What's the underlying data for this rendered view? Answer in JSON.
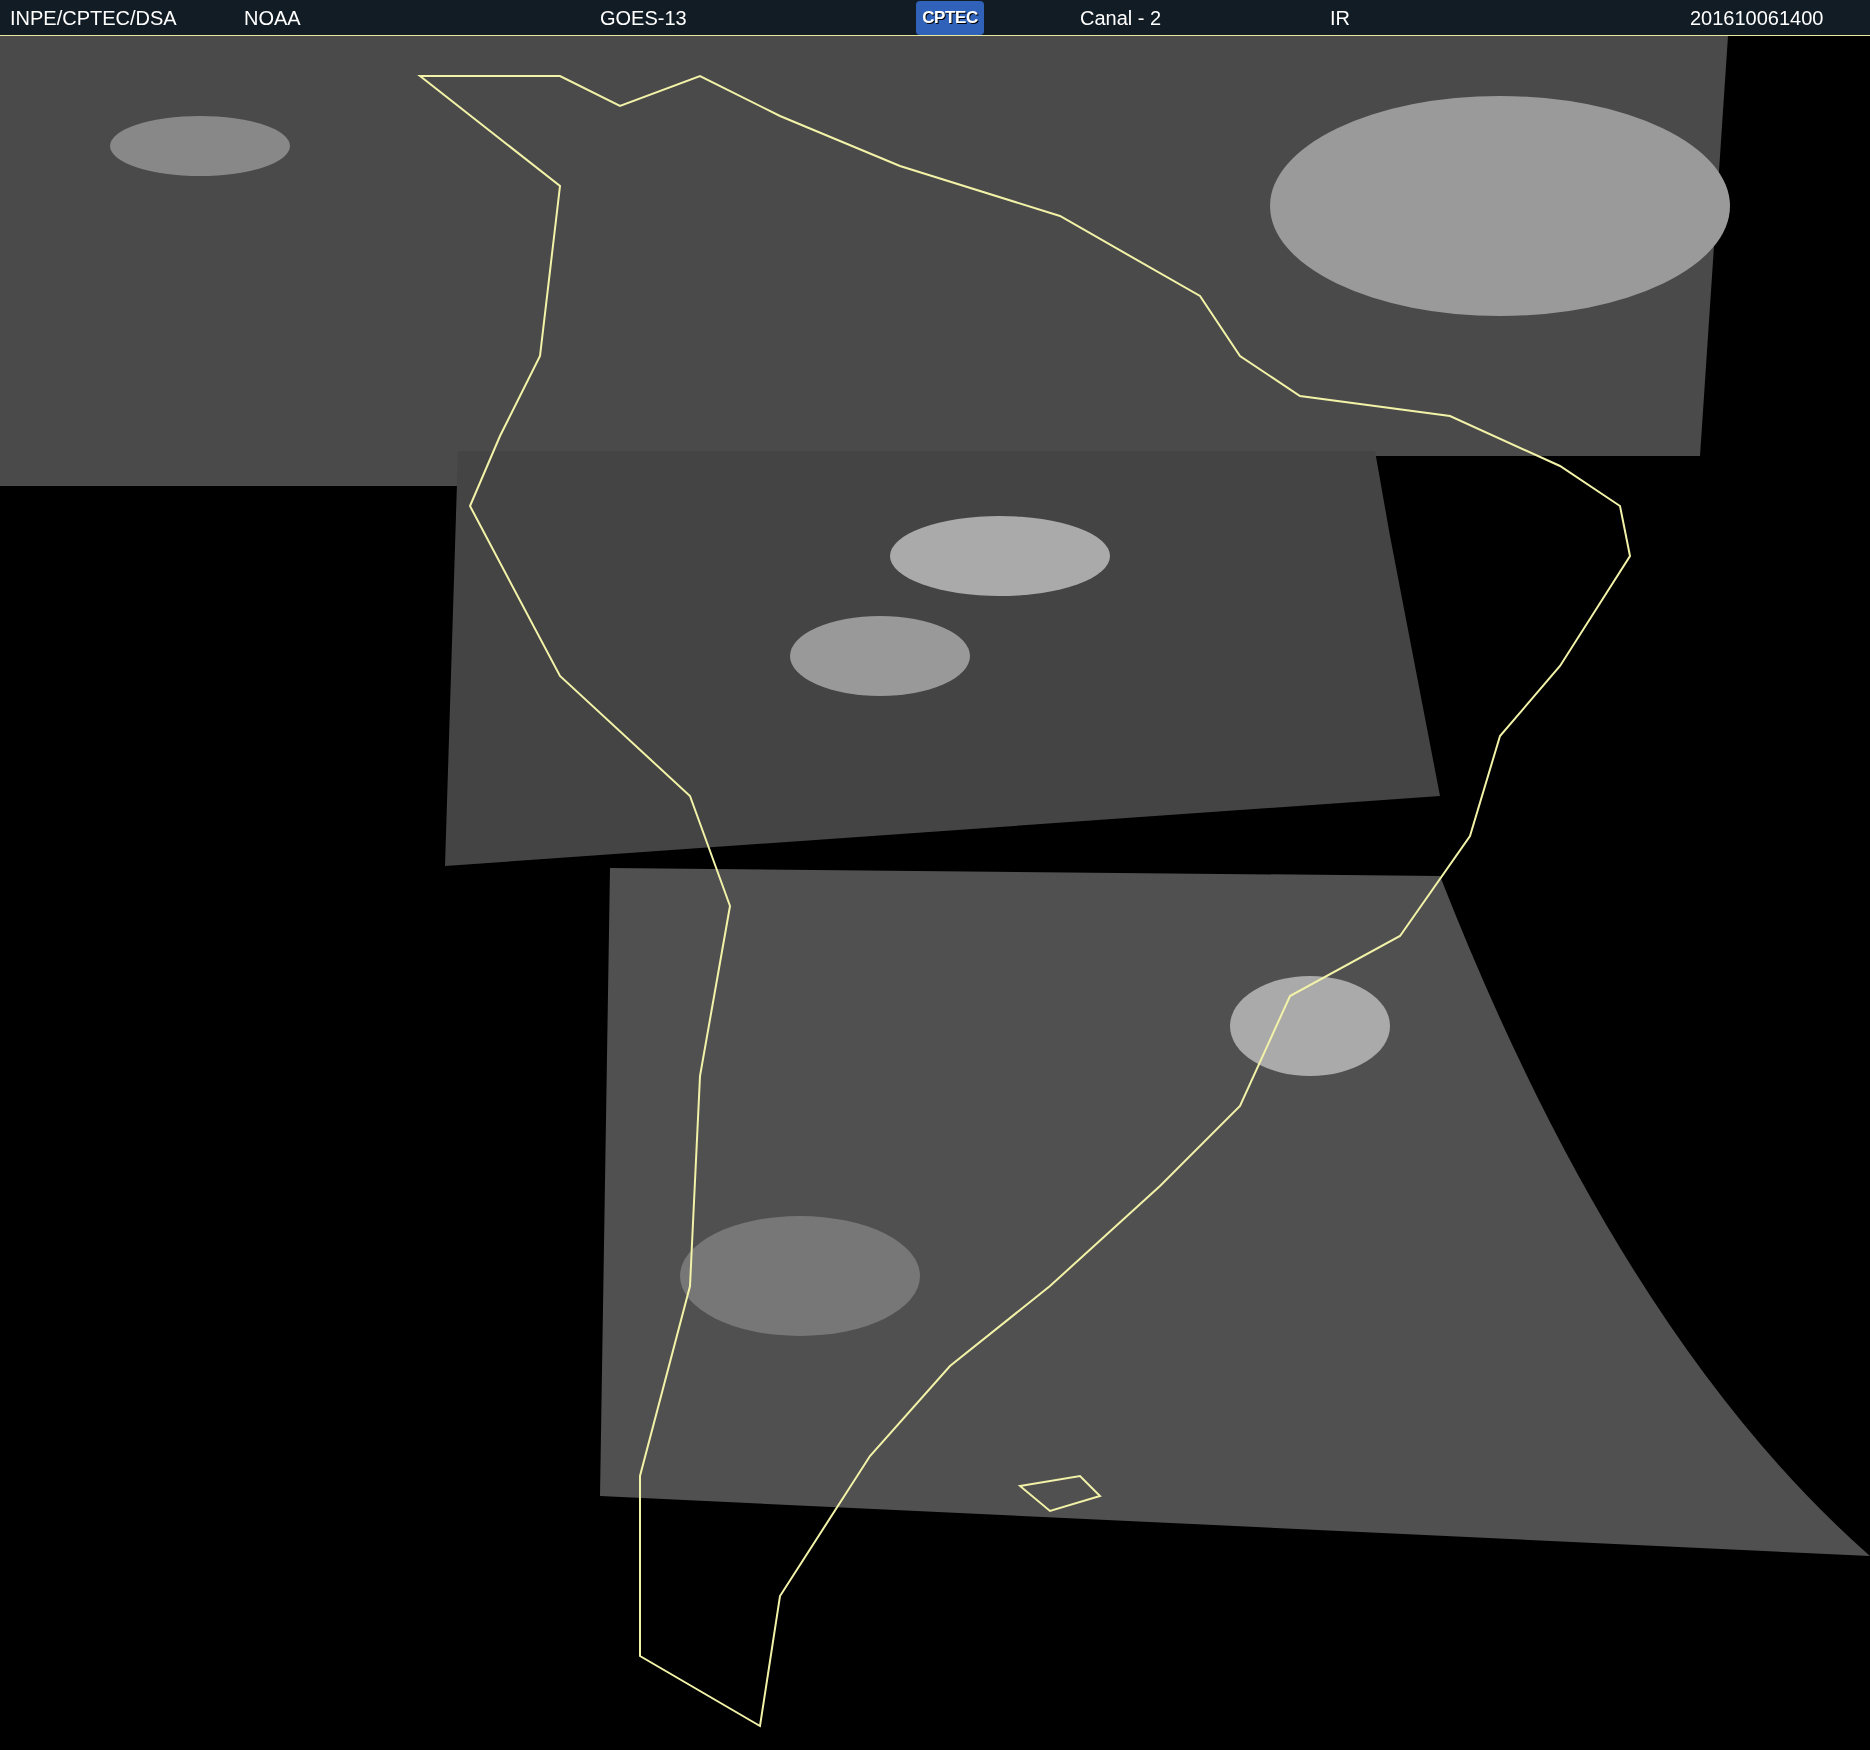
{
  "header": {
    "items": [
      {
        "kind": "text",
        "text": "INPE/CPTEC/DSA"
      },
      {
        "kind": "text",
        "text": "NOAA"
      },
      {
        "kind": "text",
        "text": "GOES-13"
      },
      {
        "kind": "logo",
        "text": "CPTEC"
      },
      {
        "kind": "text",
        "text": "Canal - 2"
      },
      {
        "kind": "text",
        "text": "IR"
      },
      {
        "kind": "text",
        "text": "201610061400"
      }
    ]
  }
}
